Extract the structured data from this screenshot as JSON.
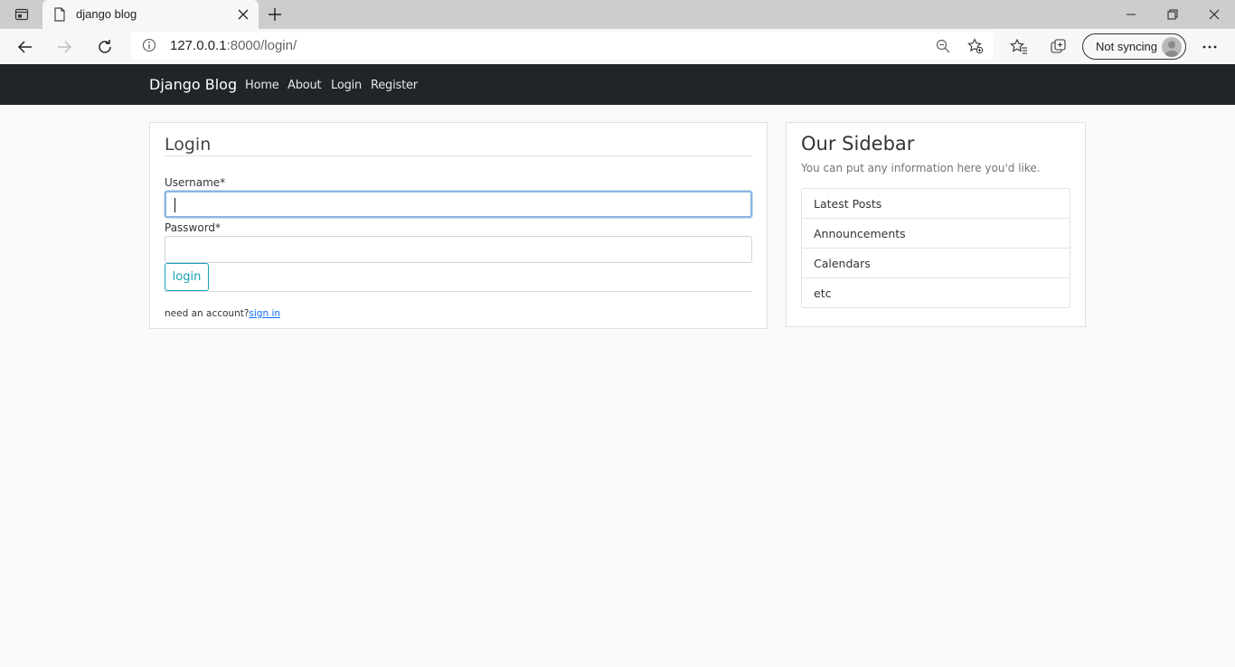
{
  "browser": {
    "tab_title": "django blog",
    "url_host": "127.0.0.1",
    "url_rest": ":8000/login/",
    "sync_label": "Not syncing"
  },
  "site": {
    "brand": "Django Blog",
    "nav": [
      "Home",
      "About",
      "Login",
      "Register"
    ]
  },
  "login": {
    "title": "Login",
    "username_label": "Username*",
    "username_value": "",
    "password_label": "Password*",
    "password_value": "",
    "button_label": "login",
    "account_prompt": "need an account?",
    "signin_link": "sign in"
  },
  "sidebar": {
    "title": "Our Sidebar",
    "subtitle": "You can put any information here you'd like.",
    "items": [
      "Latest Posts",
      "Announcements",
      "Calendars",
      "etc"
    ]
  },
  "colors": {
    "navbar_bg": "#212529",
    "accent_info": "#17a2b8",
    "link": "#0d6efd",
    "page_bg": "#fafafa"
  }
}
